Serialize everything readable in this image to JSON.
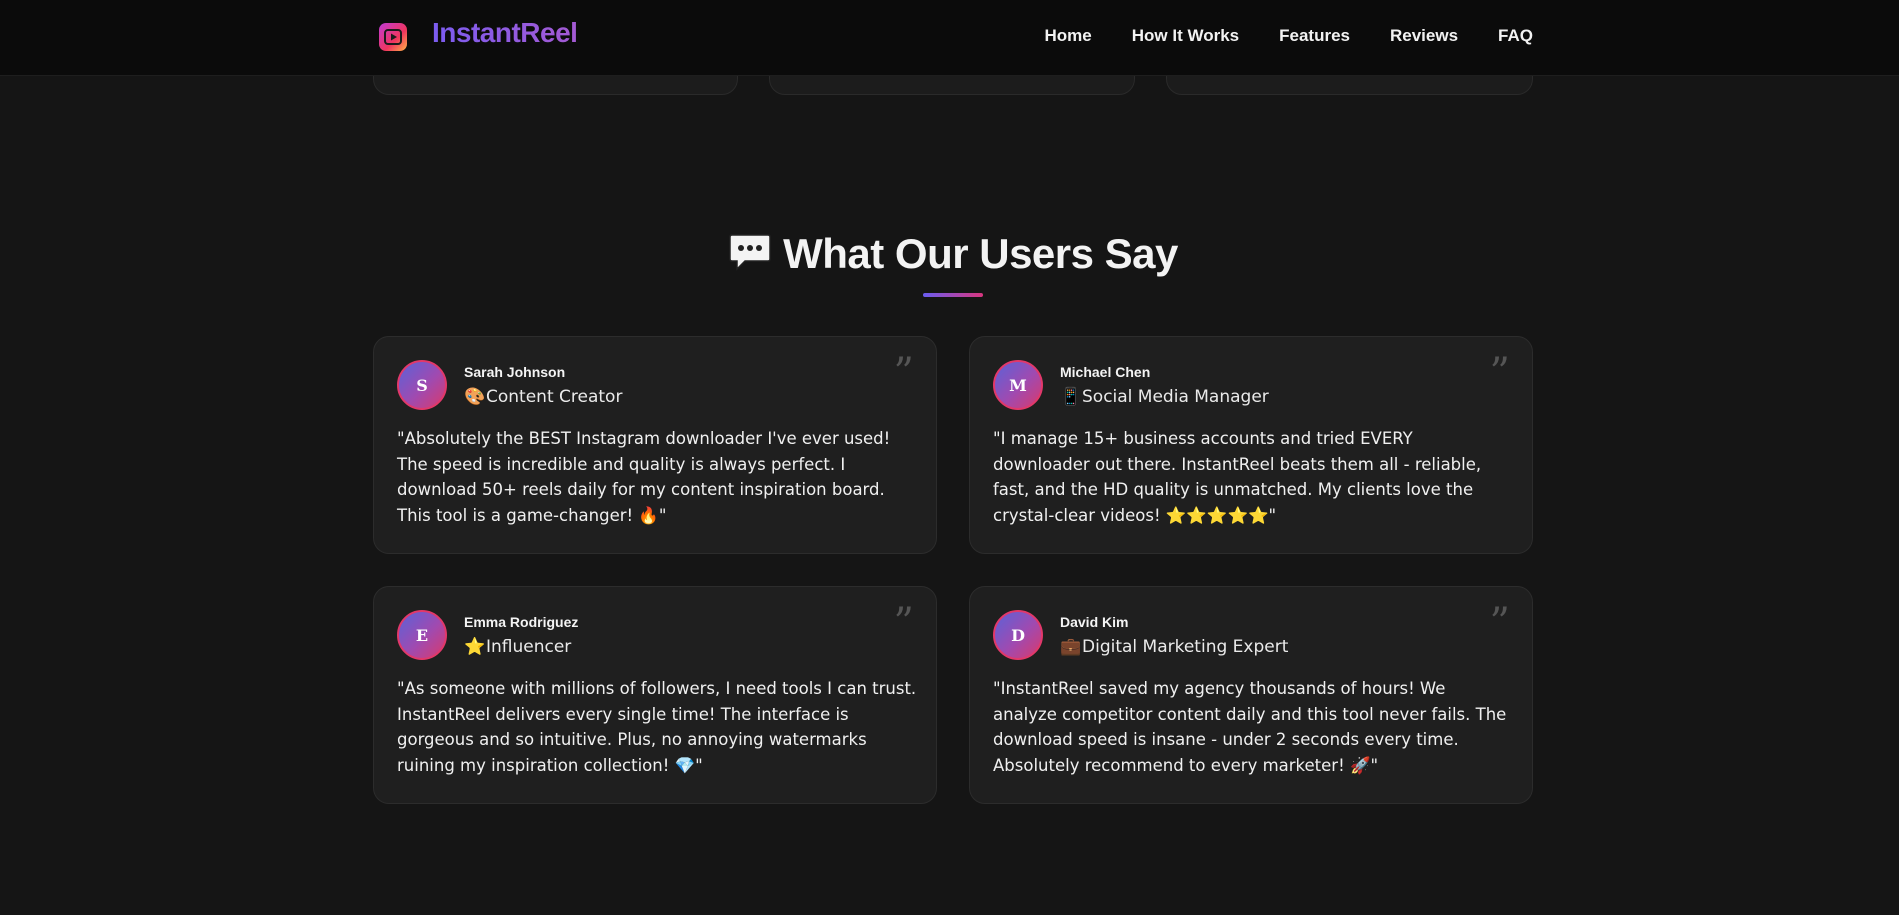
{
  "brand": {
    "name": "InstantReel"
  },
  "nav": {
    "items": [
      "Home",
      "How It Works",
      "Features",
      "Reviews",
      "FAQ"
    ]
  },
  "section": {
    "title": "What Our Users Say",
    "icon": "speech-bubble-icon"
  },
  "reviews": [
    {
      "initial": "S",
      "name": "Sarah Johnson",
      "role_icon": "🎨",
      "role": "Content Creator",
      "text": "\"Absolutely the BEST Instagram downloader I've ever used! The speed is incredible and quality is always perfect. I download 50+ reels daily for my content inspiration board. This tool is a game-changer! 🔥\""
    },
    {
      "initial": "M",
      "name": "Michael Chen",
      "role_icon": "📱",
      "role": "Social Media Manager",
      "text": "\"I manage 15+ business accounts and tried EVERY downloader out there. InstantReel beats them all - reliable, fast, and the HD quality is unmatched. My clients love the crystal-clear videos! ⭐⭐⭐⭐⭐\""
    },
    {
      "initial": "E",
      "name": "Emma Rodriguez",
      "role_icon": "⭐",
      "role": "Influencer",
      "text": "\"As someone with millions of followers, I need tools I can trust. InstantReel delivers every single time! The interface is gorgeous and so intuitive. Plus, no annoying watermarks ruining my inspiration collection! 💎\""
    },
    {
      "initial": "D",
      "name": "David Kim",
      "role_icon": "💼",
      "role": "Digital Marketing Expert",
      "text": "\"InstantReel saved my agency thousands of hours! We analyze competitor content daily and this tool never fails. The download speed is insane - under 2 seconds every time. Absolutely recommend to every marketer! 🚀\""
    }
  ],
  "quote_glyph": "”",
  "colors": {
    "accent_start": "#6a5cf0",
    "accent_end": "#d9367f",
    "background": "#151515"
  }
}
